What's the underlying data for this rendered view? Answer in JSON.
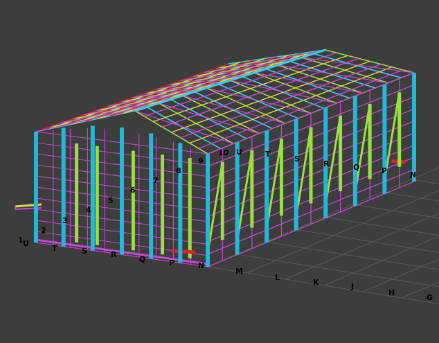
{
  "viewport": {
    "background": "#3d3d3d",
    "colors": {
      "column": "#22b8d8",
      "column_light": "#38d0ee",
      "beam": "#c848d8",
      "bracing": "#98e040",
      "purlin_yellow": "#e8d840",
      "member_red": "#e02030",
      "ground_grid": "#5a5a5a",
      "label": "#000000"
    }
  },
  "grid_labels": {
    "ground_axis": [
      "M",
      "L",
      "K",
      "J",
      "H",
      "G"
    ],
    "front_axis": [
      "U",
      "T",
      "S",
      "R",
      "Q",
      "P",
      "N"
    ],
    "near_numbers": [
      "1",
      "2",
      "3",
      "4",
      "5",
      "6",
      "7",
      "8",
      "9"
    ],
    "far_side": [
      "10",
      "U",
      "T",
      "S",
      "R",
      "Q",
      "P",
      "N"
    ]
  },
  "icons": {
    "model": "steel-structure-3d-model"
  }
}
